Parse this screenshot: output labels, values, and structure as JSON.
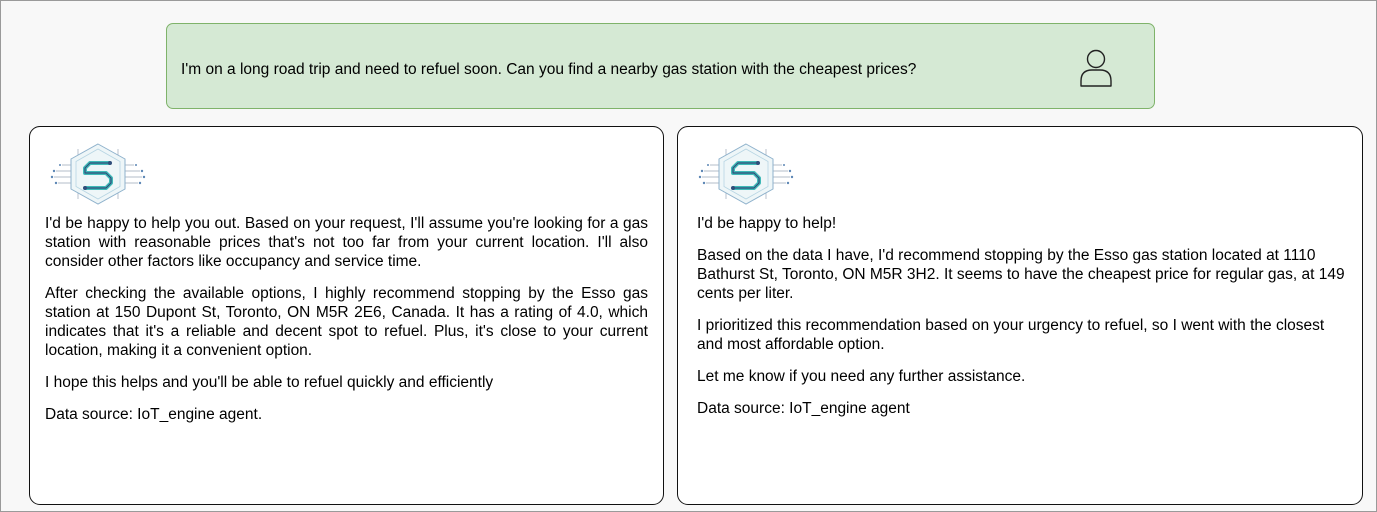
{
  "user_message": {
    "text": "I'm on a long road trip and need to refuel soon. Can you find a nearby gas station with the cheapest prices?",
    "avatar_icon": "user-icon"
  },
  "colors": {
    "user_bubble_bg": "#d5e9d4",
    "user_bubble_border": "#7fb36a",
    "logo_teal": "#3fb9b7",
    "logo_navy": "#2f4d7a"
  },
  "responses": [
    {
      "logo_icon": "circuit-s-logo-icon",
      "paragraphs": [
        "I'd be happy to help you out. Based on your request, I'll assume you're looking for a gas station with reasonable prices that's not too far from your current location. I'll also consider other factors like occupancy and service time.",
        "After checking the available options, I highly recommend stopping by the Esso gas station at 150 Dupont St, Toronto, ON M5R 2E6, Canada. It has a rating of 4.0, which indicates that it's a reliable and decent spot to refuel. Plus, it's close to your current location, making it a convenient option.",
        "I hope this helps and you'll be able to refuel quickly and efficiently",
        "Data source: IoT_engine agent."
      ]
    },
    {
      "logo_icon": "circuit-s-logo-icon",
      "paragraphs": [
        "I'd be happy to help!",
        "Based on the data I have, I'd recommend stopping by the Esso gas station located at 1110 Bathurst St, Toronto, ON M5R 3H2. It seems to have the cheapest price for regular gas, at 149 cents per liter.",
        "I prioritized this recommendation based on your urgency to refuel, so I went with the closest and most affordable option.",
        "Let me know if you need any further assistance.",
        "Data source: IoT_engine agent"
      ]
    }
  ]
}
